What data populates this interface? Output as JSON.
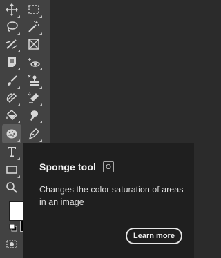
{
  "toolbar": {
    "tools": [
      {
        "name": "move-tool",
        "icon": "move-icon"
      },
      {
        "name": "marquee-tool",
        "icon": "rectangular-marquee-icon"
      },
      {
        "name": "lasso-tool",
        "icon": "lasso-icon"
      },
      {
        "name": "magic-wand-tool",
        "icon": "magic-wand-icon"
      },
      {
        "name": "crop-tool",
        "icon": "crop-icon"
      },
      {
        "name": "frame-tool",
        "icon": "frame-icon"
      },
      {
        "name": "note-tool",
        "icon": "note-icon"
      },
      {
        "name": "eyedropper-tool",
        "icon": "eyedropper-eye-icon"
      },
      {
        "name": "brush-tool",
        "icon": "brush-icon"
      },
      {
        "name": "stamp-tool",
        "icon": "clone-stamp-icon"
      },
      {
        "name": "spot-healing-tool",
        "icon": "spot-healing-icon"
      },
      {
        "name": "eraser-tool",
        "icon": "eraser-icon"
      },
      {
        "name": "paint-bucket-tool",
        "icon": "paint-bucket-icon"
      },
      {
        "name": "smudge-tool",
        "icon": "smudge-icon"
      },
      {
        "name": "sponge-tool",
        "icon": "sponge-icon",
        "active": true
      },
      {
        "name": "pen-tool",
        "icon": "pen-icon"
      },
      {
        "name": "type-tool",
        "icon": "type-icon"
      },
      {
        "name": "rectangle-tool",
        "icon": "rectangle-icon"
      },
      {
        "name": "zoom-tool",
        "icon": "zoom-icon"
      }
    ],
    "colors": {
      "foreground": "#ffffff",
      "background": "#000000"
    }
  },
  "tooltip": {
    "title": "Sponge tool",
    "shortcut": "O",
    "description": "Changes the color saturation of areas in an image",
    "button": "Learn more"
  },
  "colors": {
    "toolbar_bg": "#424242",
    "canvas_bg": "#2b2b2b",
    "tooltip_bg": "#1f1f1f",
    "active_tool_bg": "#5d5d5d"
  }
}
